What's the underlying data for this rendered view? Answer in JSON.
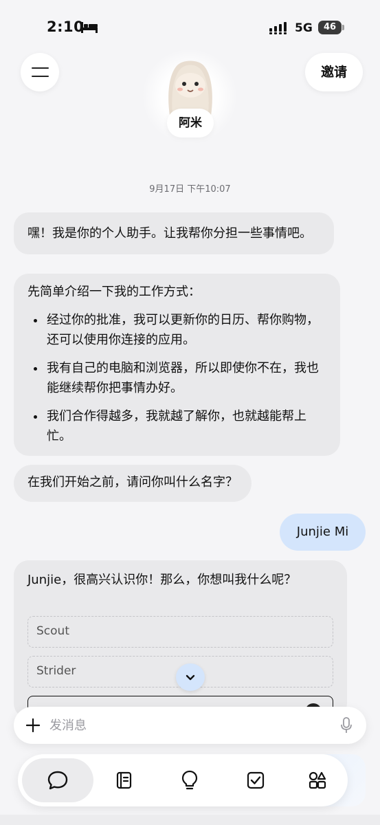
{
  "status_bar": {
    "time": "2:10",
    "network": "5G",
    "battery": "46"
  },
  "header": {
    "invite_label": "邀请",
    "assistant_name": "阿米"
  },
  "chat": {
    "timestamp": "9月17日 下午10:07",
    "msg1": "嘿！我是你的个人助手。让我帮你分担一些事情吧。",
    "msg2_intro": "先简单介绍一下我的工作方式：",
    "msg2_points": [
      "经过你的批准，我可以更新你的日历、帮你购物，还可以使用你连接的应用。",
      "我有自己的电脑和浏览器，所以即使你不在，我也能继续帮你把事情办好。",
      "我们合作得越多，我就越了解你，也就越能帮上忙。"
    ],
    "msg3": "在我们开始之前，请问你叫什么名字？",
    "user_reply": "Junjie Mi",
    "msg4": "Junjie，很高兴认识你！那么，你想叫我什么呢？",
    "options": [
      "Scout",
      "Strider"
    ]
  },
  "composer": {
    "placeholder": "发消息"
  },
  "tabs": [
    {
      "name": "chat",
      "icon": "chat-bubble-icon",
      "active": true
    },
    {
      "name": "notes",
      "icon": "notebook-icon",
      "active": false
    },
    {
      "name": "ideas",
      "icon": "lightbulb-icon",
      "active": false
    },
    {
      "name": "tasks",
      "icon": "checkbox-icon",
      "active": false
    },
    {
      "name": "apps",
      "icon": "shapes-icon",
      "active": false
    }
  ],
  "colors": {
    "background": "#f5f5f7",
    "incoming_bubble": "#e9e9eb",
    "outgoing_bubble": "#d4e5fc"
  }
}
